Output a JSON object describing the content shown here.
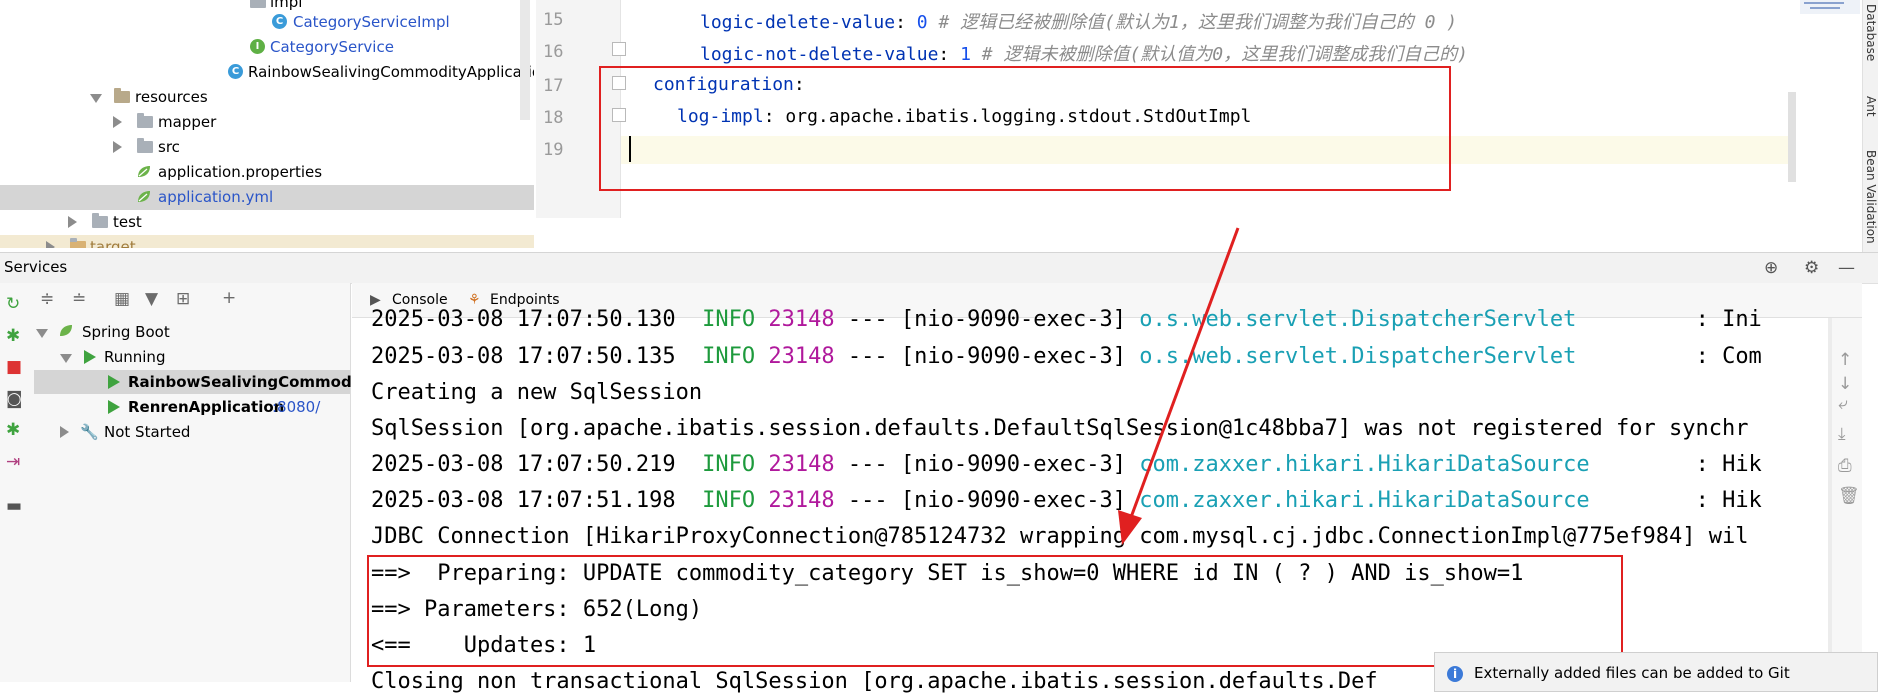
{
  "project_tree": {
    "items": [
      {
        "label": "impl",
        "icon": "folder-icon"
      },
      {
        "label": "CategoryServiceImpl",
        "icon": "class-icon"
      },
      {
        "label": "CategoryService",
        "icon": "interface-icon"
      },
      {
        "label": "RainbowSealivingCommodityApplication",
        "icon": "spring-class-icon"
      },
      {
        "label": "resources",
        "icon": "resources-folder-icon"
      },
      {
        "label": "mapper",
        "icon": "folder-icon"
      },
      {
        "label": "src",
        "icon": "folder-icon"
      },
      {
        "label": "application.properties",
        "icon": "spring-config-icon"
      },
      {
        "label": "application.yml",
        "icon": "spring-config-icon",
        "selected": true
      },
      {
        "label": "test",
        "icon": "folder-icon"
      },
      {
        "label": "target",
        "icon": "folder-icon"
      }
    ]
  },
  "editor": {
    "lines": [
      {
        "num": "15",
        "key": "logic-delete-value",
        "value": "0",
        "comment": "# 逻辑已经被删除值(默认为1，这里我们调整为我们自己的 0 )"
      },
      {
        "num": "16",
        "key": "logic-not-delete-value",
        "value": "1",
        "comment": "# 逻辑未被删除值(默认值为0，这里我们调整成我们自己的)"
      },
      {
        "num": "17",
        "key": "configuration",
        "value": "",
        "comment": ""
      },
      {
        "num": "18",
        "key": "log-impl",
        "value": "org.apache.ibatis.logging.stdout.StdOutImpl",
        "comment": ""
      },
      {
        "num": "19",
        "key": "",
        "value": "",
        "comment": ""
      }
    ],
    "side_tabs": [
      "Database",
      "Ant",
      "Bean Validation"
    ]
  },
  "services": {
    "title": "Services",
    "tree": {
      "spring_boot": "Spring Boot",
      "running": "Running",
      "app1": "RainbowSealivingCommodity",
      "app2": "RenrenApplication",
      "app2_port": ":8080/",
      "not_started": "Not Started"
    },
    "tabs": {
      "console": "Console",
      "endpoints": "Endpoints"
    }
  },
  "console": {
    "lines": [
      {
        "ts": "2025-03-08 17:07:50.130",
        "level": "INFO",
        "pid": "23148",
        "thread": "--- [nio-9090-exec-3]",
        "logger": "o.s.web.servlet.DispatcherServlet",
        "msg": ": Ini"
      },
      {
        "ts": "2025-03-08 17:07:50.135",
        "level": "INFO",
        "pid": "23148",
        "thread": "--- [nio-9090-exec-3]",
        "logger": "o.s.web.servlet.DispatcherServlet",
        "msg": ": Com"
      },
      {
        "plain": "Creating a new SqlSession"
      },
      {
        "plain": "SqlSession [org.apache.ibatis.session.defaults.DefaultSqlSession@1c48bba7] was not registered for synchr"
      },
      {
        "ts": "2025-03-08 17:07:50.219",
        "level": "INFO",
        "pid": "23148",
        "thread": "--- [nio-9090-exec-3]",
        "logger": "com.zaxxer.hikari.HikariDataSource",
        "msg": ": Hik"
      },
      {
        "ts": "2025-03-08 17:07:51.198",
        "level": "INFO",
        "pid": "23148",
        "thread": "--- [nio-9090-exec-3]",
        "logger": "com.zaxxer.hikari.HikariDataSource",
        "msg": ": Hik"
      },
      {
        "plain": "JDBC Connection [HikariProxyConnection@785124732 wrapping com.mysql.cj.jdbc.ConnectionImpl@775ef984] wil"
      },
      {
        "plain": "==>  Preparing: UPDATE commodity_category SET is_show=0 WHERE id IN ( ? ) AND is_show=1"
      },
      {
        "plain": "==> Parameters: 652(Long)"
      },
      {
        "plain": "<==    Updates: 1"
      },
      {
        "plain": "Closing non transactional SqlSession [org.apache.ibatis.session.defaults.Def"
      }
    ]
  },
  "notification": {
    "text": "Externally added files can be added to Git"
  },
  "colors": {
    "annotation": "#e02020",
    "info": "#1d9a3c",
    "pid": "#b0199c",
    "logger": "#1aa0b4"
  }
}
